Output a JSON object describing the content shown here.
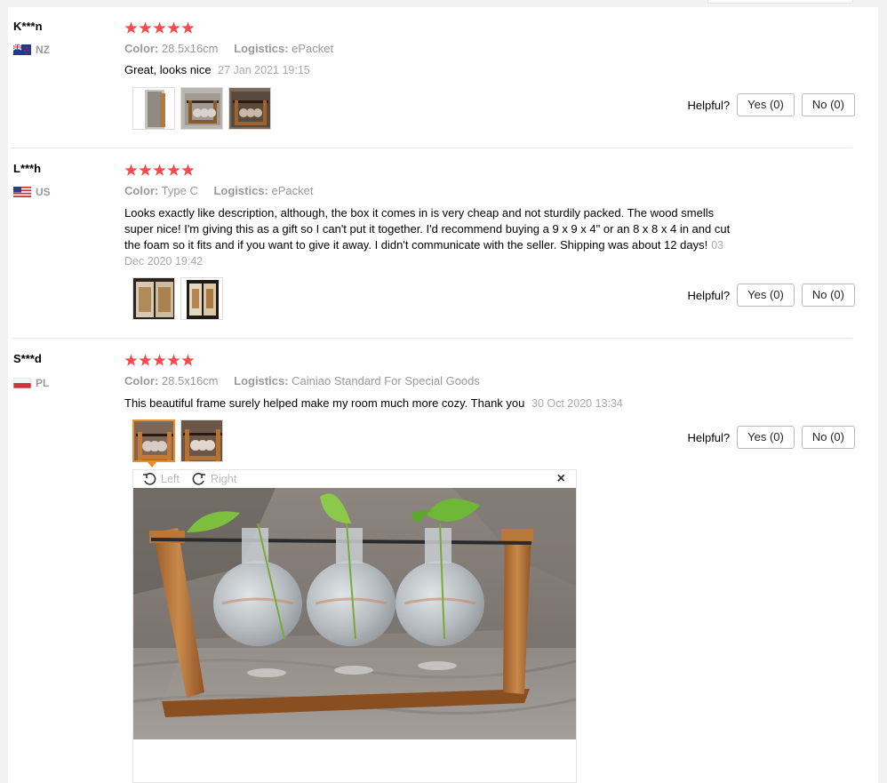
{
  "reviews": [
    {
      "user": "K***n",
      "country": "NZ",
      "color_label": "Color:",
      "color_value": "28.5x16cm",
      "logistics_label": "Logistics:",
      "logistics_value": "ePacket",
      "text": "Great, looks nice",
      "date": "27 Jan 2021 19:15",
      "helpful_label": "Helpful?",
      "yes_label": "Yes (0)",
      "no_label": "No (0)",
      "stars": 5
    },
    {
      "user": "L***h",
      "country": "US",
      "color_label": "Color:",
      "color_value": "Type C",
      "logistics_label": "Logistics:",
      "logistics_value": "ePacket",
      "text_lines": [
        "Looks exactly like description, although, the box it comes in is very cheap and not sturdily packed. The wood smells",
        "super nice! I'm giving this as a gift so I can't put it together. I'd recommend buying a 9 x 9 x 4\" or an 8 x 8 x 4 in and cut",
        "the foam so it fits and if you want to give it away. I didn't communicate with the seller. Shipping was about 12 days!"
      ],
      "date_part1": "03",
      "date_part2": "Dec 2020 19:42",
      "helpful_label": "Helpful?",
      "yes_label": "Yes (0)",
      "no_label": "No (0)",
      "stars": 5
    },
    {
      "user": "S***d",
      "country": "PL",
      "color_label": "Color:",
      "color_value": "28.5x16cm",
      "logistics_label": "Logistics:",
      "logistics_value": "Cainiao Standard For Special Goods",
      "text": "This beautiful frame surely helped make my room much more cozy. Thank you",
      "date": "30 Oct 2020 13:34",
      "helpful_label": "Helpful?",
      "yes_label": "Yes (0)",
      "no_label": "No (0)",
      "stars": 5
    }
  ],
  "viewer": {
    "rotate_left_label": "Left",
    "rotate_right_label": "Right",
    "close_label": "×"
  },
  "colors": {
    "star": "#f04e4e",
    "accent_selected": "#f08c2a",
    "muted_text": "#999999"
  },
  "icons": [
    "star-icon",
    "rotate-left-icon",
    "rotate-right-icon",
    "close-icon",
    "flag-nz-icon",
    "flag-us-icon",
    "flag-pl-icon"
  ]
}
